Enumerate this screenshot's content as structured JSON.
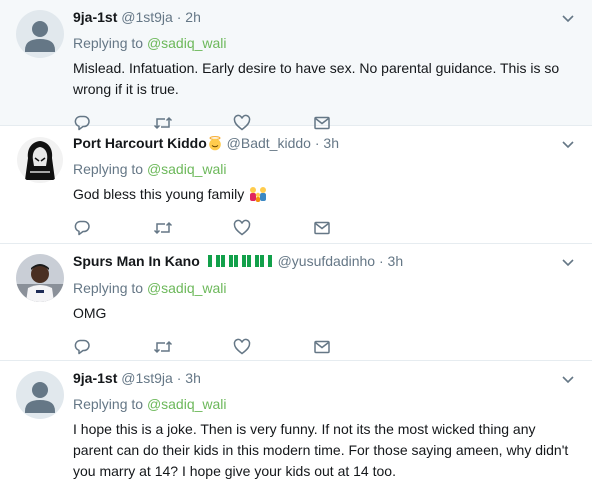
{
  "tweets": [
    {
      "name": "9ja-1st",
      "handle": "@1st9ja",
      "time": "2h",
      "replying_prefix": "Replying to",
      "mention": "@sadiq_wali",
      "text": "Mislead.  Infatuation. Early desire to have sex.  No parental guidance. This is so wrong if it is true.",
      "avatar": "default-avatar"
    },
    {
      "name": "Port Harcourt Kiddo",
      "handle": "@Badt_kiddo",
      "time": "3h",
      "replying_prefix": "Replying to",
      "mention": "@sadiq_wali",
      "text": "God bless this young family",
      "avatar": "hooded-figure-avatar"
    },
    {
      "name": "Spurs Man In Kano",
      "handle": "@yusufdadinho",
      "time": "3h",
      "replying_prefix": "Replying to",
      "mention": "@sadiq_wali",
      "text": "OMG",
      "avatar": "photo-avatar"
    },
    {
      "name": "9ja-1st",
      "handle": "@1st9ja",
      "time": "3h",
      "replying_prefix": "Replying to",
      "mention": "@sadiq_wali",
      "text": "I hope this is a joke. Then is very funny.  If not its the most wicked thing any parent can do their kids in this modern time.  For those saying ameen, why didn't you marry at 14? I hope give your kids out at 14 too.",
      "avatar": "default-avatar"
    }
  ],
  "separator": "·",
  "colors": {
    "mention": "#6cb85a",
    "muted": "#657786",
    "highlight_bg": "#f5f8fa",
    "border": "#e6ecf0"
  },
  "icons": [
    "reply-icon",
    "retweet-icon",
    "like-icon",
    "dm-icon",
    "chevron-down-icon"
  ]
}
